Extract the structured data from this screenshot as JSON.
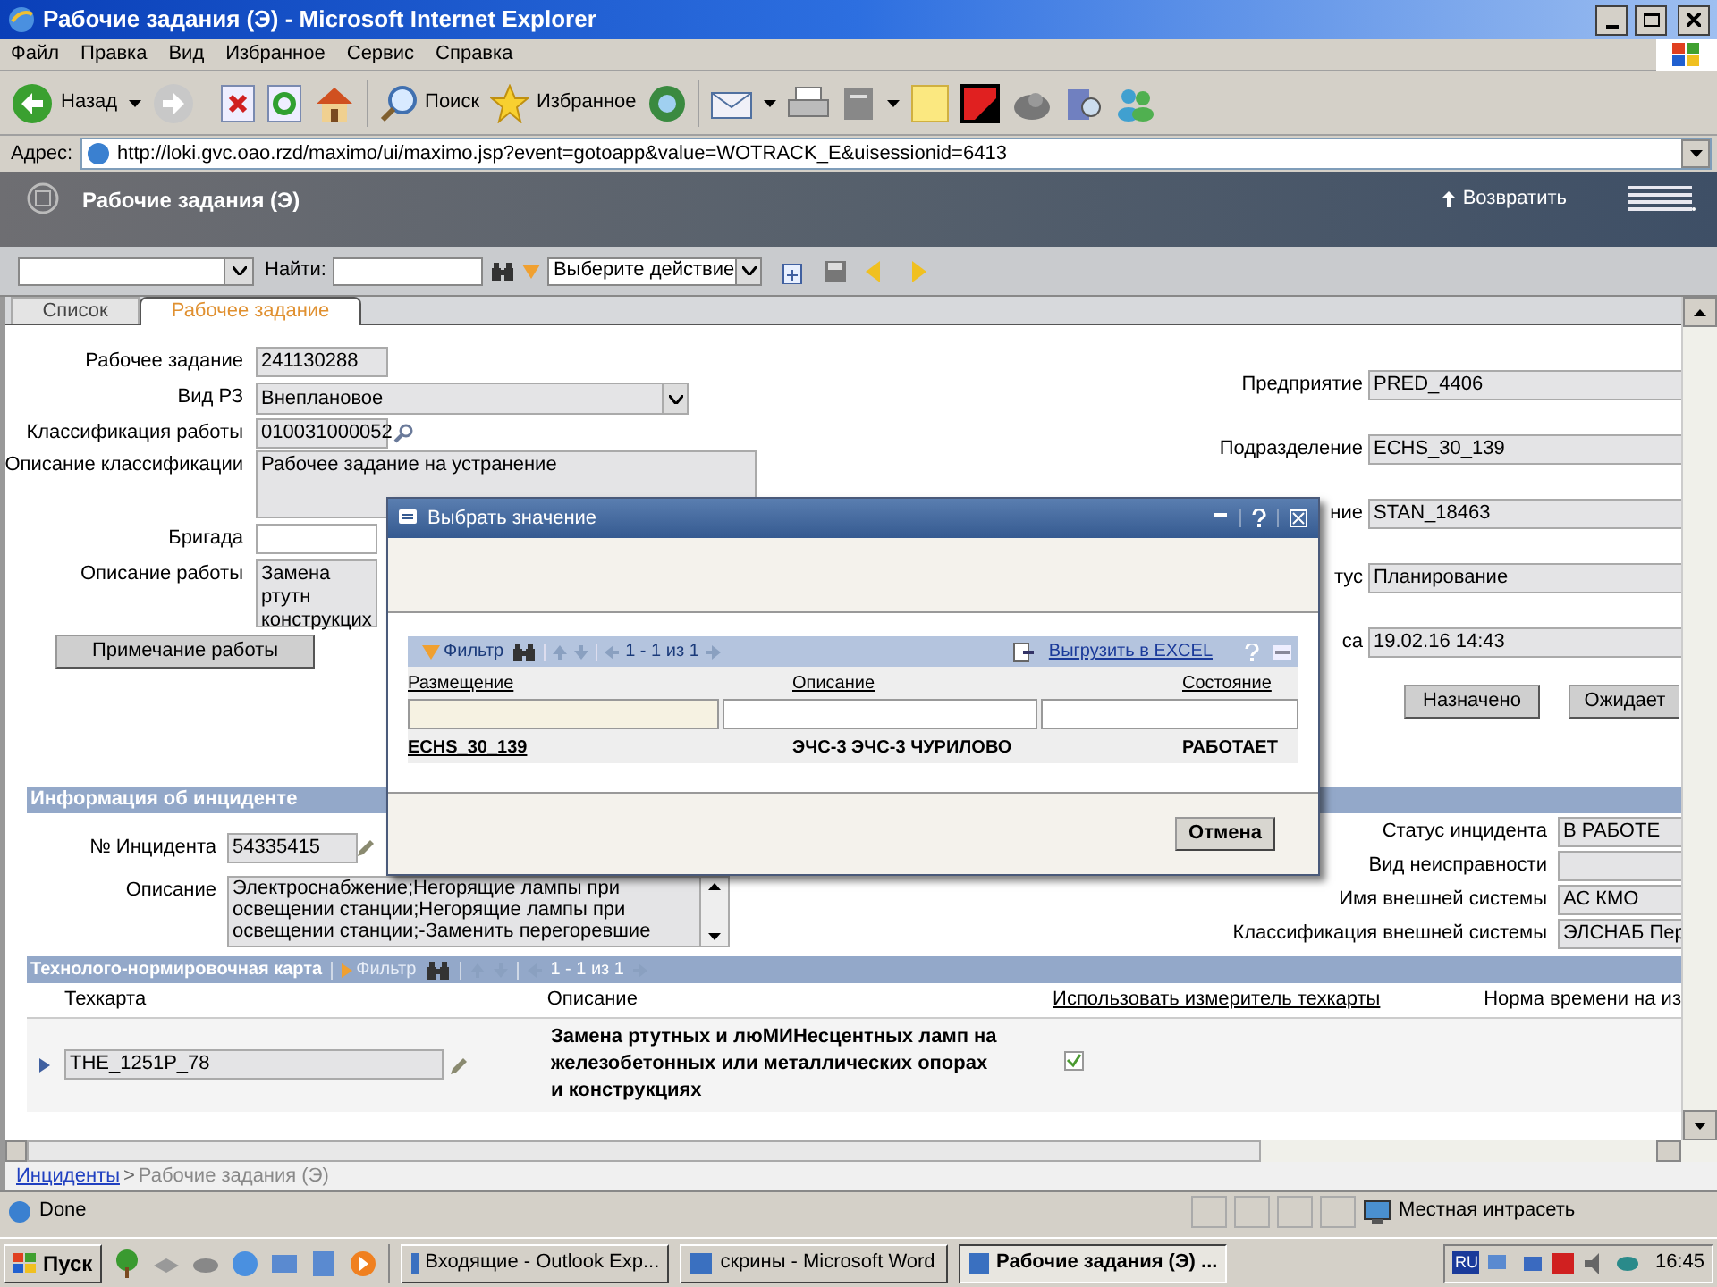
{
  "window": {
    "title": "Рабочие задания (Э) - Microsoft Internet Explorer"
  },
  "menu": [
    "Файл",
    "Правка",
    "Вид",
    "Избранное",
    "Сервис",
    "Справка"
  ],
  "toolbar": {
    "back": "Назад",
    "search": "Поиск",
    "favorites": "Избранное"
  },
  "address": {
    "label": "Адрес:",
    "url": "http://loki.gvc.oao.rzd/maximo/ui/maximo.jsp?event=gotoapp&value=WOTRACK_E&uisessionid=6413"
  },
  "app_header": {
    "title": "Рабочие задания (Э)",
    "return_link": "Возвратить"
  },
  "app_toolbar": {
    "find_label": "Найти:",
    "action_select": "Выберите действие"
  },
  "tabs": [
    {
      "label": "Список",
      "selected": false
    },
    {
      "label": "Рабочее задание",
      "selected": true
    }
  ],
  "work_order": {
    "left_fields": [
      {
        "label": "Рабочее задание",
        "value": "241130288",
        "kind": "text"
      },
      {
        "label": "Вид РЗ",
        "value": "Внеплановое",
        "kind": "select"
      },
      {
        "label": "Классификация работы",
        "value": "010031000052",
        "kind": "lookup"
      },
      {
        "label": "Описание классификации",
        "value": "Рабочее задание на устранение",
        "kind": "textarea"
      },
      {
        "label": "Бригада",
        "kind": "text"
      },
      {
        "label": "Описание работы",
        "value": "Замена ртутн\nконструкцих",
        "kind": "textarea"
      }
    ],
    "note_button": "Примечание работы",
    "right_fields": [
      {
        "label": "Предприятие",
        "value": "PRED_4406"
      },
      {
        "label": "Подразделение",
        "value": "ECHS_30_139"
      },
      {
        "label": "ние",
        "value": "STAN_18463"
      },
      {
        "label": "тус",
        "value": "Планирование"
      },
      {
        "label": "са",
        "value": "19.02.16 14:43"
      }
    ],
    "status_buttons": [
      "Назначено",
      "Ожидает"
    ]
  },
  "incident": {
    "title": "Информация об инциденте",
    "number_label": "№ Инцидента",
    "number": "54335415",
    "description_label": "Описание",
    "description": "Электроснабжение;Негорящие лампы при освещении станции;Негорящие лампы при освещении станции;-Заменить перегоревшие",
    "right_fields": [
      {
        "label": "Статус инцидента",
        "value": "В РАБОТЕ"
      },
      {
        "label": "Вид неисправности"
      },
      {
        "label": "Имя внешней системы",
        "value": "АС КМО"
      },
      {
        "label": "Классификация внешней системы",
        "value": "ЭЛСНАБ Пер"
      }
    ]
  },
  "tech_card": {
    "title": "Технолого-нормировочная карта",
    "filter": "Фильтр",
    "pager": "1 - 1 из 1",
    "columns": [
      "Техкарта",
      "Описание",
      "Использовать измеритель техкарты",
      "Норма времени на из"
    ],
    "rows": [
      {
        "card": "THE_1251P_78",
        "description": "Замена ртутных и люМИНесцентных ламп на железобетонных или металлических опорах и конструкциях",
        "use_meter": true
      }
    ]
  },
  "dialog": {
    "title": "Выбрать значение",
    "filter": "Фильтр",
    "pager": "1 - 1 из 1",
    "export": "Выгрузить в EXCEL",
    "columns": [
      "Размещение",
      "Описание",
      "Состояние"
    ],
    "rows": [
      {
        "cells": [
          "ECHS_30_139",
          "ЭЧС-3 ЭЧС-3 ЧУРИЛОВО",
          "РАБОТАЕТ"
        ]
      }
    ],
    "cancel": "Отмена"
  },
  "breadcrumb": {
    "link": "Инциденты",
    "separator": ">",
    "current": "Рабочие задания (Э)"
  },
  "status_bar": {
    "text": "Done",
    "zone": "Местная интрасеть"
  },
  "taskbar": {
    "start": "Пуск",
    "tasks": [
      {
        "label": "Входящие - Outlook Exp...",
        "selected": false
      },
      {
        "label": "скрины - Microsoft Word",
        "selected": false
      },
      {
        "label": "Рабочие задания (Э) ...",
        "selected": true
      }
    ],
    "language": "RU",
    "clock": "16:45"
  }
}
